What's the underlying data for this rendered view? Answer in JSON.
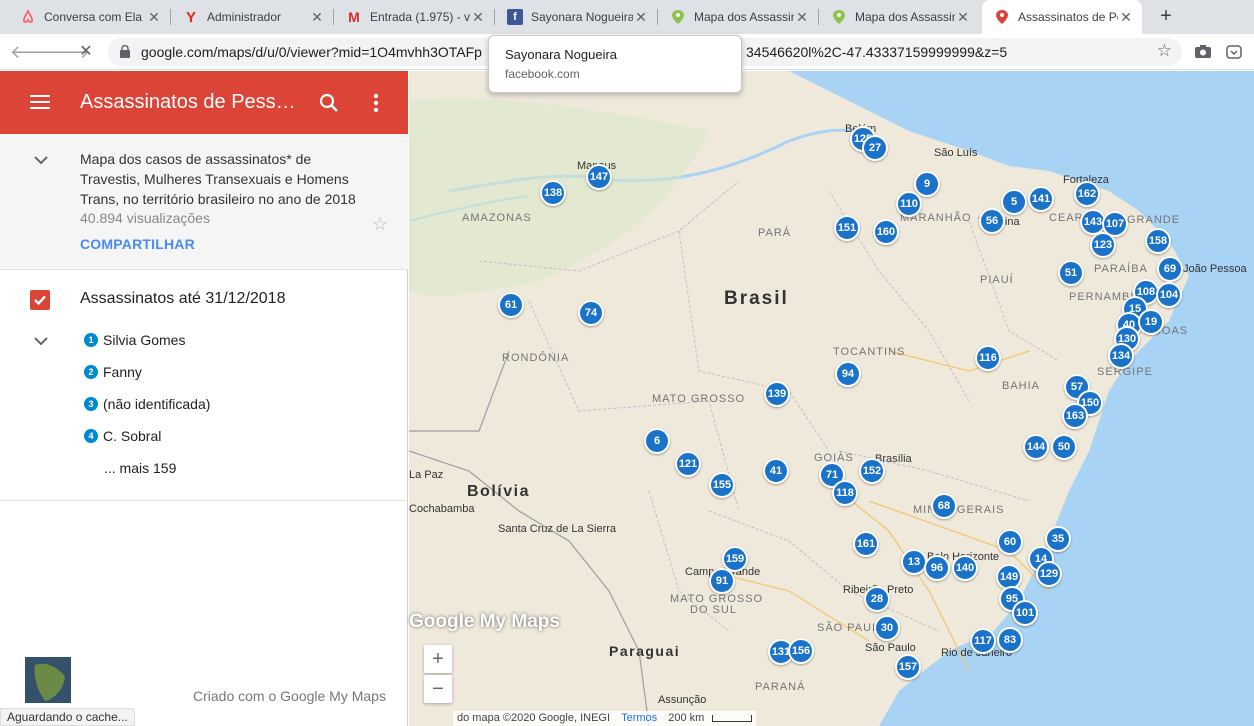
{
  "browser": {
    "tabs": [
      {
        "title": "Conversa com Ela",
        "icon": "airbnb-icon"
      },
      {
        "title": "Administrador",
        "icon": "yandex-icon"
      },
      {
        "title": "Entrada (1.975) - v",
        "icon": "gmail-icon"
      },
      {
        "title": "Sayonara Nogueira",
        "icon": "facebook-icon"
      },
      {
        "title": "Mapa dos Assassin",
        "icon": "my-maps-icon"
      },
      {
        "title": "Mapa dos Assassin",
        "icon": "my-maps-icon"
      },
      {
        "title": "Assassinatos de Pe",
        "icon": "my-maps-icon",
        "active": true
      }
    ],
    "url": "google.com/maps/d/u/0/viewer?mid=1O4mvhh3OTAFp",
    "url_tail": "34546620l%2C-47.43337159999999&z=5",
    "tooltip": {
      "title": "Sayonara Nogueira",
      "domain": "facebook.com"
    },
    "status_text": "Aguardando o cache..."
  },
  "panel": {
    "title": "Assassinatos de Pessoas Trans",
    "description": "Mapa dos casos de assassinatos* de Travestis, Mulheres Transexuais e Homens Trans, no território brasileiro no ano de 2018",
    "views": "40.894 visualizações",
    "share_label": "COMPARTILHAR",
    "layer": {
      "name": "Assassinatos até 31/12/2018",
      "items": [
        {
          "num": "1",
          "label": "Silvia Gomes"
        },
        {
          "num": "2",
          "label": "Fanny"
        },
        {
          "num": "3",
          "label": "(não identificada)"
        },
        {
          "num": "4",
          "label": "C. Sobral"
        }
      ],
      "more": "... mais 159"
    },
    "credit": "Criado com o Google My Maps"
  },
  "map": {
    "labels": {
      "brasil": "Brasil",
      "bolivia": "Bolívia",
      "paraguai": "Paraguai",
      "amazonas": "AMAZONAS",
      "para": "PARÁ",
      "maranhao": "MARANHÃO",
      "piaui": "PIAUÍ",
      "ceara": "CEARÁ",
      "rn": "GRANDE",
      "paraiba": "PARAÍBA",
      "pernambuco": "PERNAMBUCO",
      "alagoas": "AGOAS",
      "sergipe": "SERGIPE",
      "bahia": "BAHIA",
      "tocantins": "TOCANTINS",
      "rondonia": "RONDÔNIA",
      "mato_grosso": "MATO GROSSO",
      "goias": "GOIÁS",
      "minas": "MINAS GERAIS",
      "ms1": "MATO GROSSO",
      "ms2": "DO SUL",
      "sao_paulo": "SÃO PAULO",
      "parana": "PARANÁ",
      "sao_luis": "São Luís",
      "manaus": "Manaus",
      "belem": "Belém",
      "fortaleza": "Fortaleza",
      "teresina": "Teresina",
      "joao_pessoa": "João Pessoa",
      "natal": "Natal",
      "brasilia": "Brasília",
      "bh": "Belo Horizonte",
      "campo_grande": "Campo Grande",
      "ribeirao": "Ribeirão Preto",
      "sao_paulo_city": "São Paulo",
      "rio": "Rio de Janeiro",
      "la_paz": "La Paz",
      "cochabamba": "Cochabamba",
      "santa_cruz": "Santa Cruz de La Sierra",
      "assuncao": "Assunção"
    },
    "markers": [
      "125",
      "27",
      "147",
      "138",
      "9",
      "110",
      "5",
      "141",
      "162",
      "143",
      "107",
      "151",
      "160",
      "56",
      "123",
      "158",
      "69",
      "51",
      "108",
      "104",
      "15",
      "40",
      "19",
      "130",
      "134",
      "61",
      "74",
      "116",
      "94",
      "139",
      "57",
      "150",
      "163",
      "6",
      "121",
      "155",
      "41",
      "71",
      "152",
      "118",
      "144",
      "50",
      "68",
      "161",
      "60",
      "35",
      "13",
      "96",
      "140",
      "149",
      "14",
      "129",
      "159",
      "91",
      "28",
      "95",
      "101",
      "30",
      "117",
      "83",
      "131",
      "156",
      "157"
    ],
    "zoom_in": "+",
    "zoom_out": "−",
    "watermark": "Google My Maps",
    "attribution": "do mapa ©2020 Google, INEGI",
    "terms": "Termos",
    "scale": "200 km"
  }
}
